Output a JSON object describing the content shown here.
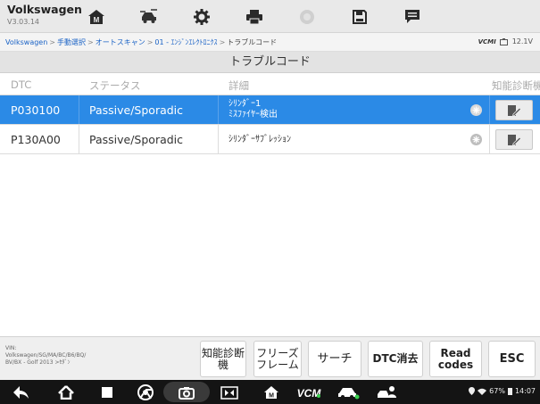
{
  "app": {
    "title": "Volkswagen",
    "version": "V3.03.14"
  },
  "toolbar": {
    "buttons": [
      {
        "name": "home",
        "icon": "home-icon"
      },
      {
        "name": "vehicle-swap",
        "icon": "car-swap-icon"
      },
      {
        "name": "settings",
        "icon": "gear-icon"
      },
      {
        "name": "print",
        "icon": "printer-icon"
      },
      {
        "name": "help",
        "icon": "help-icon"
      },
      {
        "name": "save",
        "icon": "save-icon"
      },
      {
        "name": "data-logging",
        "icon": "chat-icon"
      }
    ]
  },
  "breadcrumb": {
    "items": [
      "Volkswagen",
      "手動選択",
      "オートスキャン",
      "01 - ｴﾝｼﾞﾝｴﾚｸﾄﾛﾆｸｽ",
      "トラブルコード"
    ],
    "separator": ">"
  },
  "vci": {
    "label": "VCMI",
    "battery": "12.1V"
  },
  "page": {
    "title": "トラブルコード"
  },
  "table": {
    "headers": {
      "dtc": "DTC",
      "status": "ステータス",
      "detail": "詳細",
      "smart": "知能診断機"
    },
    "rows": [
      {
        "dtc": "P030100",
        "status": "Passive/Sporadic",
        "detail_line1": "ｼﾘﾝﾀﾞｰ1",
        "detail_line2": "ﾐｽﾌｧｲﾔｰ検出",
        "selected": true
      },
      {
        "dtc": "P130A00",
        "status": "Passive/Sporadic",
        "detail_line1": "ｼﾘﾝﾀﾞｰｻﾌﾞﾚｯｼｮﾝ",
        "detail_line2": "",
        "selected": false
      }
    ]
  },
  "vin_info": {
    "line1": "VIN:",
    "line2": "Volkswagen/SG/MA/BC/B6/BQ/",
    "line3": "BV/BX - Golf 2013 >ｾﾀﾞﾝ"
  },
  "functions": {
    "smart_diag_l1": "知能診断",
    "smart_diag_l2": "機",
    "freeze_l1": "フリーズ",
    "freeze_l2": "フレーム",
    "search": "サーチ",
    "clear": "DTC消去",
    "read_l1": "Read",
    "read_l2": "codes",
    "esc": "ESC"
  },
  "system_status": {
    "battery": "67%",
    "time": "14:07"
  },
  "colors": {
    "accent": "#2b8ae6",
    "toolbar_bg": "#e9e9e9"
  }
}
